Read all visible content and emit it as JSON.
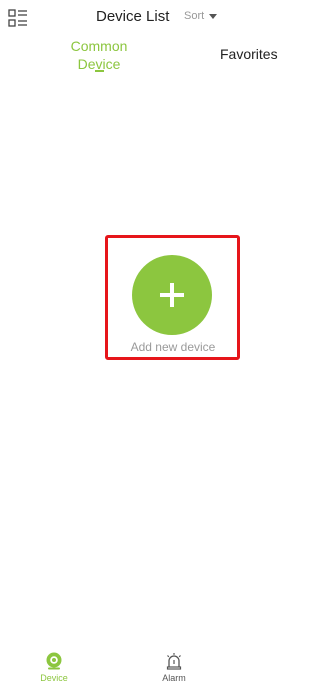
{
  "header": {
    "title": "Device List",
    "sort_label": "Sort",
    "menu_icon": "list-grid-icon",
    "sort_caret_icon": "caret-down-icon"
  },
  "tabs": [
    {
      "label": "Common Device",
      "active": true
    },
    {
      "label": "Favorites",
      "active": false
    }
  ],
  "add_device": {
    "label": "Add new device",
    "icon": "plus-icon"
  },
  "bottom_nav": [
    {
      "label": "Device",
      "icon": "camera-icon",
      "active": true
    },
    {
      "label": "Alarm",
      "icon": "alarm-siren-icon",
      "active": false
    }
  ],
  "colors": {
    "accent": "#8cc63f",
    "highlight_border": "#e6151a",
    "inactive_text": "#999999"
  }
}
